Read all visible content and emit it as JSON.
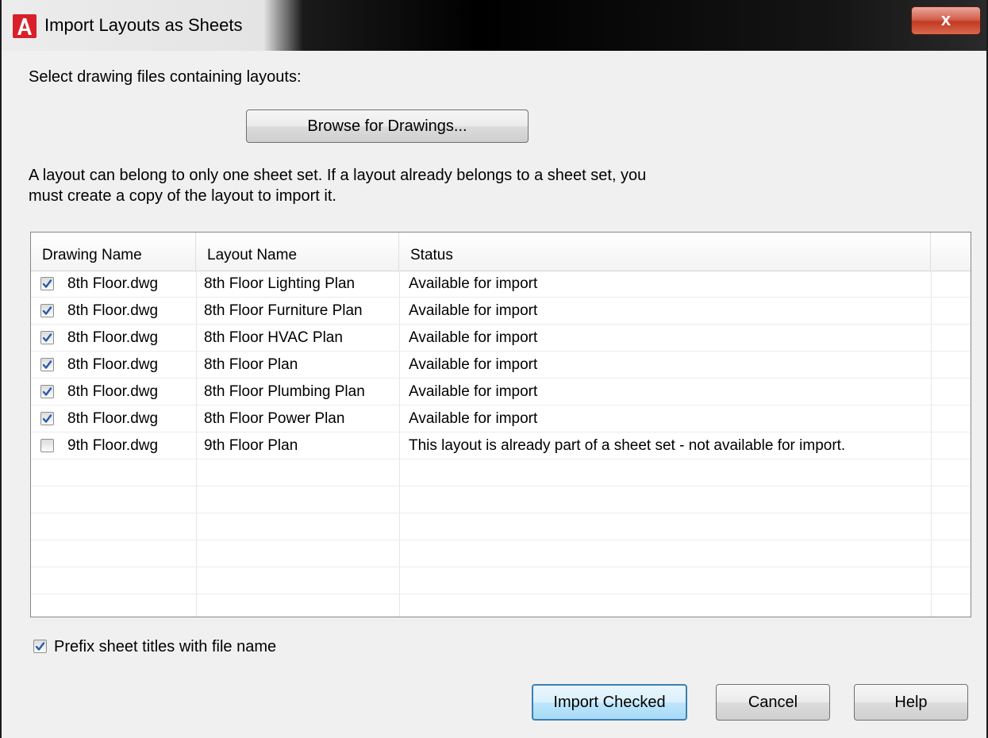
{
  "window": {
    "title": "Import Layouts as Sheets",
    "close_label": "x"
  },
  "instructions": {
    "select_label": "Select drawing files containing layouts:",
    "browse_label": "Browse for Drawings...",
    "note_line1": "A layout can belong to only one sheet set. If a layout already belongs to a sheet set, you",
    "note_line2": "must create a copy of the layout to import it."
  },
  "table": {
    "columns": [
      "Drawing Name",
      "Layout Name",
      "Status"
    ],
    "rows": [
      {
        "checked": true,
        "drawing": "8th Floor.dwg",
        "layout": "8th Floor Lighting Plan",
        "status": "Available for import"
      },
      {
        "checked": true,
        "drawing": "8th Floor.dwg",
        "layout": "8th Floor Furniture Plan",
        "status": "Available for import"
      },
      {
        "checked": true,
        "drawing": "8th Floor.dwg",
        "layout": "8th Floor HVAC Plan",
        "status": "Available for import"
      },
      {
        "checked": true,
        "drawing": "8th Floor.dwg",
        "layout": "8th Floor Plan",
        "status": "Available for import"
      },
      {
        "checked": true,
        "drawing": "8th Floor.dwg",
        "layout": "8th Floor Plumbing Plan",
        "status": "Available for import"
      },
      {
        "checked": true,
        "drawing": "8th Floor.dwg",
        "layout": "8th Floor Power Plan",
        "status": "Available for import"
      },
      {
        "checked": false,
        "drawing": "9th Floor.dwg",
        "layout": "9th Floor Plan",
        "status": "This layout is already part of a sheet set - not available for import."
      }
    ]
  },
  "options": {
    "prefix_checked": true,
    "prefix_label": "Prefix sheet titles with file name"
  },
  "buttons": {
    "import_label": "Import Checked",
    "cancel_label": "Cancel",
    "help_label": "Help"
  },
  "colors": {
    "accent": "#3c7fb1",
    "app_icon": "#d8202a",
    "close": "#c23a22",
    "check": "#2a5aa8"
  },
  "icons": {
    "app": "autocad-a-icon",
    "close": "close-icon",
    "check": "checkmark-icon"
  }
}
